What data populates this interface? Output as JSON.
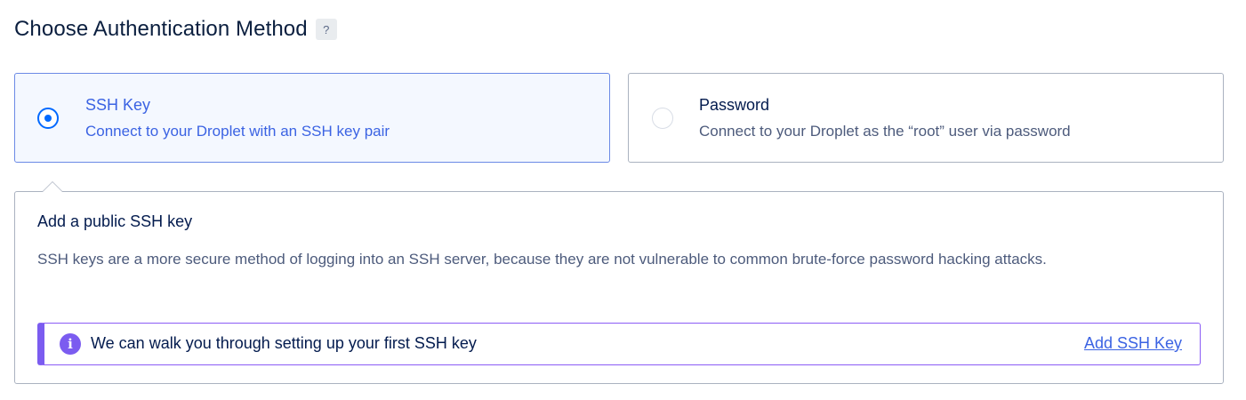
{
  "header": {
    "title": "Choose Authentication Method",
    "help_label": "?"
  },
  "options": [
    {
      "title": "SSH Key",
      "description": "Connect to your Droplet with an SSH key pair",
      "selected": true
    },
    {
      "title": "Password",
      "description": "Connect to your Droplet as the “root” user via password",
      "selected": false
    }
  ],
  "panel": {
    "title": "Add a public SSH key",
    "body": "SSH keys are a more secure method of logging into an SSH server, because they are not vulnerable to common brute-force password hacking attacks.",
    "notice": {
      "icon": "info-icon",
      "text": "We can walk you through setting up your first SSH key",
      "link_label": "Add SSH Key"
    }
  },
  "colors": {
    "accent": "#0069ff",
    "selected_text": "#3b63e3",
    "notice_accent": "#7b5cf0"
  }
}
